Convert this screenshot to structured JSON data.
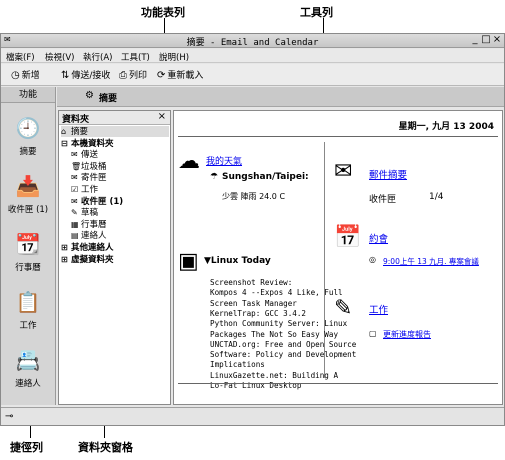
{
  "callouts": {
    "menubar_label": "功能表列",
    "toolbar_label": "工具列",
    "shortcut_label": "捷徑列",
    "folderpane_label": "資料夾窗格"
  },
  "window": {
    "title": "摘要 - Email and Calendar",
    "minimize": "_",
    "maximize": "□",
    "close": "×"
  },
  "menu": [
    "檔案(F)",
    "檢視(V)",
    "執行(A)",
    "工具(T)",
    "說明(H)"
  ],
  "toolbar": {
    "new": "新增",
    "send_receive": "傳送/接收",
    "print": "列印",
    "reload": "重新載入"
  },
  "shortcut_bar": {
    "header": "功能",
    "items": [
      {
        "label": "摘要",
        "icon": "summary-icon"
      },
      {
        "label": "收件匣 (1)",
        "icon": "inbox-icon"
      },
      {
        "label": "行事曆",
        "icon": "calendar-icon"
      },
      {
        "label": "工作",
        "icon": "tasks-icon"
      },
      {
        "label": "連絡人",
        "icon": "contacts-icon"
      }
    ]
  },
  "view_header": "摘要",
  "folder_pane": {
    "title": "資料夾",
    "close": "×",
    "items": [
      {
        "label": "摘要",
        "prefix": "",
        "icon": "⌂",
        "indent": 0,
        "bold": false,
        "selected": true
      },
      {
        "label": "本機資料夾",
        "prefix": "⊟",
        "icon": "",
        "indent": 0,
        "bold": true,
        "selected": false
      },
      {
        "label": "傳送",
        "prefix": "",
        "icon": "✉",
        "indent": 1,
        "bold": false,
        "selected": false
      },
      {
        "label": "垃圾桶",
        "prefix": "",
        "icon": "🗑",
        "indent": 1,
        "bold": false,
        "selected": false
      },
      {
        "label": "寄件匣",
        "prefix": "",
        "icon": "✉",
        "indent": 1,
        "bold": false,
        "selected": false
      },
      {
        "label": "工作",
        "prefix": "",
        "icon": "☑",
        "indent": 1,
        "bold": false,
        "selected": false
      },
      {
        "label": "收件匣 (1)",
        "prefix": "",
        "icon": "✉",
        "indent": 1,
        "bold": true,
        "selected": false
      },
      {
        "label": "草稿",
        "prefix": "",
        "icon": "✎",
        "indent": 1,
        "bold": false,
        "selected": false
      },
      {
        "label": "行事曆",
        "prefix": "",
        "icon": "▦",
        "indent": 1,
        "bold": false,
        "selected": false
      },
      {
        "label": "連絡人",
        "prefix": "",
        "icon": "▤",
        "indent": 1,
        "bold": false,
        "selected": false
      },
      {
        "label": "其他連絡人",
        "prefix": "⊞",
        "icon": "",
        "indent": 0,
        "bold": true,
        "selected": false
      },
      {
        "label": "虛擬資料夾",
        "prefix": "⊞",
        "icon": "",
        "indent": 0,
        "bold": true,
        "selected": false
      }
    ]
  },
  "summary": {
    "date": "星期一, 九月 13 2004",
    "weather": {
      "title": "我的天氣",
      "city": "Sungshan/Taipei:",
      "desc": "少雲 陣雨 24.0 C"
    },
    "news": {
      "title": "Linux Today",
      "lines": [
        "Screenshot Review:",
        "Kompos 4 --Expos 4 Like, Full",
        "Screen Task Manager",
        "KernelTrap: GCC 3.4.2",
        "Python Community Server: Linux",
        "Packages The Not So Easy Way",
        "UNCTAD.org: Free and Open Source",
        "Software: Policy and Development",
        "Implications",
        "LinuxGazette.net: Building A",
        "Lo-Fat Linux Desktop"
      ]
    },
    "mail": {
      "title": "郵件摘要",
      "folder": "收件匣",
      "count": "1/4"
    },
    "appointments": {
      "title": "約會",
      "item": "9:00上午 13 九月. 專案會議"
    },
    "tasks": {
      "title": "工作",
      "item": "更新進度報告"
    }
  }
}
